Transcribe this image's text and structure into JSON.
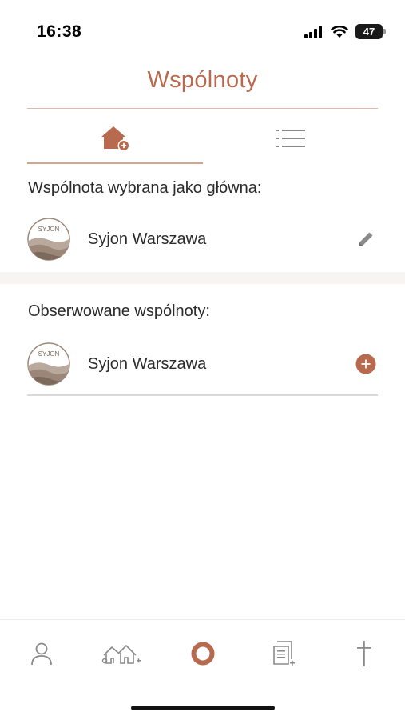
{
  "status_bar": {
    "time": "16:38",
    "battery_level": "47",
    "icons": [
      "signal-icon",
      "wifi-icon",
      "battery-icon"
    ]
  },
  "header": {
    "title": "Wspólnoty"
  },
  "tabs": [
    {
      "icon": "home-add-icon",
      "active": true
    },
    {
      "icon": "list-icon",
      "active": false
    }
  ],
  "main_section": {
    "label": "Wspólnota wybrana jako główna:",
    "community": {
      "name": "Syjon Warszawa",
      "logo_text": "SYJON",
      "action_icon": "pencil-icon"
    }
  },
  "observed_section": {
    "label": "Obserwowane wspólnoty:",
    "communities": [
      {
        "name": "Syjon Warszawa",
        "logo_text": "SYJON",
        "action_icon": "plus-circle-icon"
      }
    ]
  },
  "bottom_nav": {
    "items": [
      {
        "icon": "person-icon",
        "active": false
      },
      {
        "icon": "houses-icon",
        "active": false
      },
      {
        "icon": "ring-icon",
        "active": true
      },
      {
        "icon": "document-icon",
        "active": false
      },
      {
        "icon": "cross-icon",
        "active": false
      }
    ]
  },
  "colors": {
    "accent": "#b86a4f",
    "accent_light": "#d5a48d",
    "text": "#2b2b2b",
    "icon_gray": "#8a8a8a",
    "logo_brown": "#9b8678"
  }
}
